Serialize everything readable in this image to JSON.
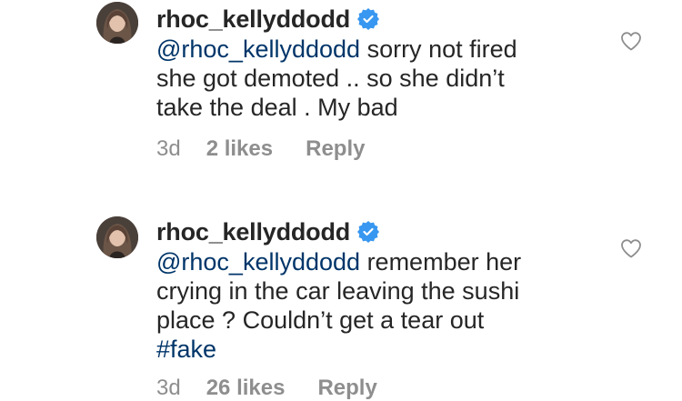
{
  "comments": [
    {
      "username": "rhoc_kellyddodd",
      "mention": "@rhoc_kellyddodd",
      "text_lines": [
        "sorry not fired",
        "she got demoted .. so she didn’t",
        "take the deal .  My bad"
      ],
      "hashtag": "",
      "age": "3d",
      "likes": "2 likes",
      "reply": "Reply"
    },
    {
      "username": "rhoc_kellyddodd",
      "mention": "@rhoc_kellyddodd",
      "text_lines": [
        "remember her",
        "crying in the car leaving the sushi",
        "place ? Couldn’t get a tear out"
      ],
      "hashtag": "#fake",
      "age": "3d",
      "likes": "26 likes",
      "reply": "Reply"
    }
  ],
  "icons": {
    "verified": "verified-badge-icon",
    "like": "heart-outline-icon"
  },
  "colors": {
    "verified": "#3897f0",
    "link": "#003569",
    "meta": "#8e8e8e",
    "text": "#262626"
  }
}
